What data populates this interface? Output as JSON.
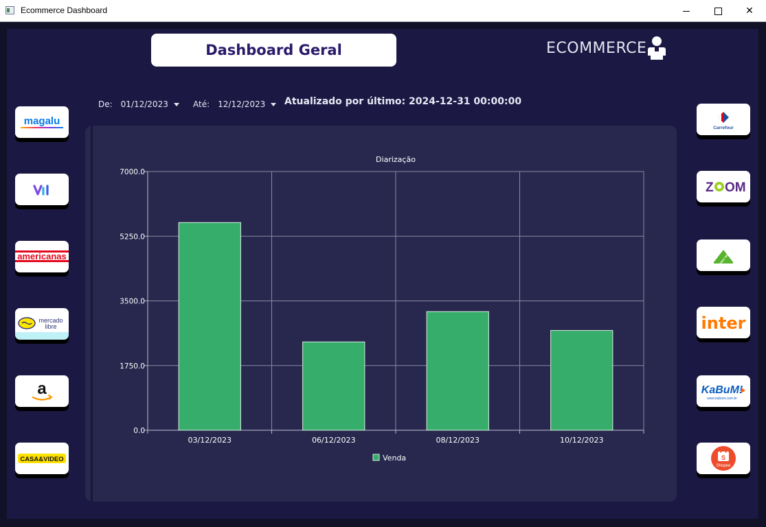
{
  "window": {
    "title": "Ecommerce Dashboard",
    "minimize_label": "",
    "maximize_label": "",
    "close_label": "✕"
  },
  "header": {
    "title": "Dashboard Geral",
    "brand": "ECOMMERCE",
    "user_icon": "user-icon"
  },
  "filters": {
    "from_label": "De:",
    "from_value": "01/12/2023",
    "to_label": "Até:",
    "to_value": "12/12/2023",
    "updated_text": "Atualizado por último: 2024-12-31 00:00:00"
  },
  "stores_left": [
    {
      "name": "magalu",
      "text": "magalu"
    },
    {
      "name": "vi",
      "text": "vi"
    },
    {
      "name": "americanas",
      "text": "americanas"
    },
    {
      "name": "mercado-libre",
      "text": "mercado libre"
    },
    {
      "name": "amazon",
      "text": "a"
    },
    {
      "name": "casa-video",
      "text": "CASA&VIDEO"
    }
  ],
  "stores_right": [
    {
      "name": "carrefour",
      "text": "Carrefour"
    },
    {
      "name": "zoom",
      "text": "ZOOM"
    },
    {
      "name": "leroy-merlin",
      "text": "LEROY MERLIN"
    },
    {
      "name": "inter",
      "text": "inter"
    },
    {
      "name": "kabum",
      "text": "KaBuM!",
      "subtext": "www.kabum.com.br"
    },
    {
      "name": "shopee",
      "text": "Shopee"
    }
  ],
  "colors": {
    "bar": "#36ad6a",
    "bar_border": "#d8f0e0",
    "background": "#1b1843",
    "card": "#28284f"
  },
  "chart_data": {
    "type": "bar",
    "title": "Diarização",
    "categories": [
      "03/12/2023",
      "06/12/2023",
      "08/12/2023",
      "10/12/2023"
    ],
    "series": [
      {
        "name": "Venda",
        "values": [
          5620,
          2390,
          3210,
          2700
        ]
      }
    ],
    "yticks": [
      "0.0",
      "1750.0",
      "3500.0",
      "5250.0",
      "7000.0"
    ],
    "ylim": [
      0,
      7000
    ],
    "grid": true,
    "legend": "bottom"
  }
}
